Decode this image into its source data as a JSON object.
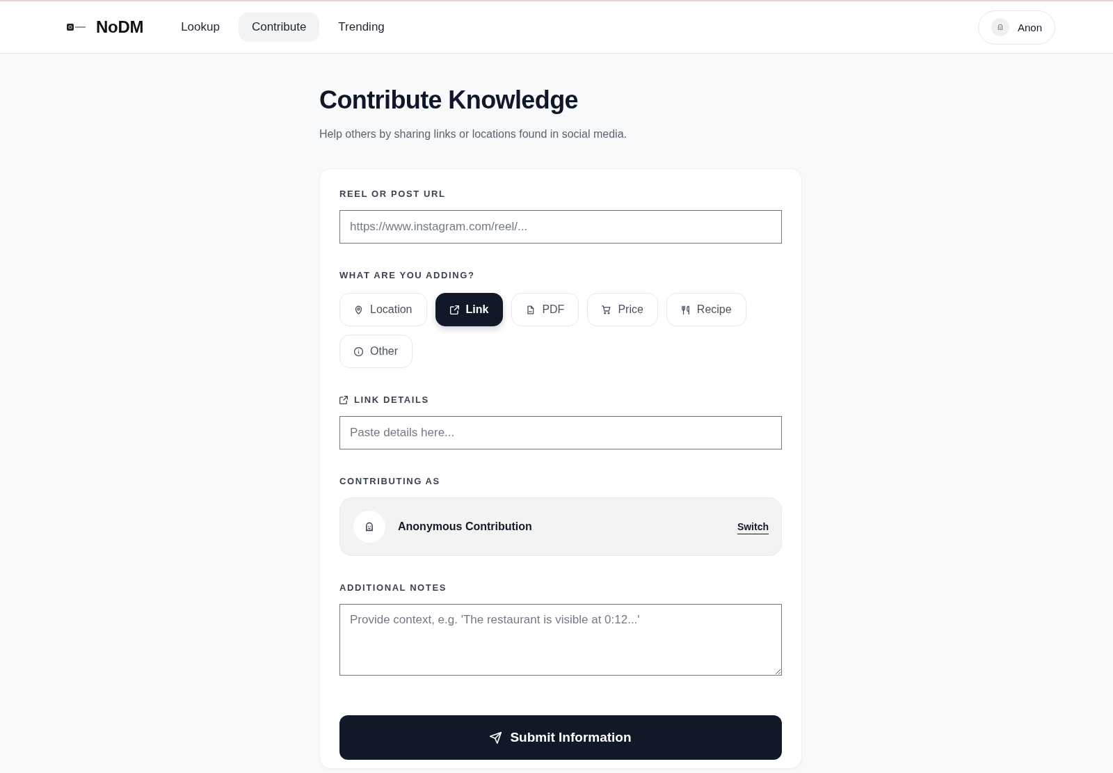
{
  "header": {
    "logo": {
      "text": "NoDM"
    },
    "nav": [
      {
        "label": "Lookup",
        "selected": false
      },
      {
        "label": "Contribute",
        "selected": true
      },
      {
        "label": "Trending",
        "selected": false
      }
    ],
    "user": {
      "label": "Anon"
    }
  },
  "page": {
    "title": "Contribute Knowledge",
    "subtitle": "Help others by sharing links or locations found in social media."
  },
  "form": {
    "url_field": {
      "label": "REEL OR POST URL",
      "placeholder": "https://www.instagram.com/reel/..."
    },
    "type_picker": {
      "label": "WHAT ARE YOU ADDING?",
      "options": [
        {
          "label": "Location",
          "kind": "location",
          "selected": false
        },
        {
          "label": "Link",
          "kind": "link",
          "selected": true
        },
        {
          "label": "PDF",
          "kind": "pdf",
          "selected": false
        },
        {
          "label": "Price",
          "kind": "price",
          "selected": false
        },
        {
          "label": "Recipe",
          "kind": "recipe",
          "selected": false
        },
        {
          "label": "Other",
          "kind": "other",
          "selected": false
        }
      ]
    },
    "details_field": {
      "label": "LINK DETAILS",
      "placeholder": "Paste details here..."
    },
    "contributor": {
      "label": "CONTRIBUTING AS",
      "name": "Anonymous Contribution",
      "action": "Switch"
    },
    "notes_field": {
      "label": "ADDITIONAL NOTES",
      "placeholder": "Provide context, e.g. 'The restaurant is visible at 0:12...'"
    },
    "submit": {
      "label": "Submit Information"
    }
  }
}
